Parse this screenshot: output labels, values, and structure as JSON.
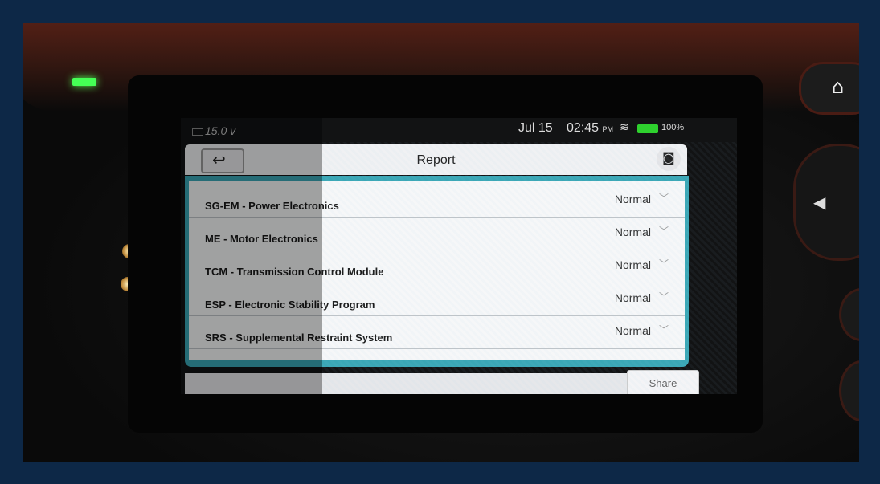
{
  "statusbar": {
    "voltage": "15.0 v",
    "date": "Jul 15",
    "time": "02:45",
    "ampm": "PM",
    "battery": "100%"
  },
  "report": {
    "title": "Report",
    "rows": [
      {
        "label": "SG-EM - Power Electronics",
        "status": "Normal"
      },
      {
        "label": "ME - Motor Electronics",
        "status": "Normal"
      },
      {
        "label": "TCM - Transmission Control Module",
        "status": "Normal"
      },
      {
        "label": "ESP - Electronic Stability Program",
        "status": "Normal"
      },
      {
        "label": "SRS - Supplemental Restraint System",
        "status": "Normal"
      }
    ],
    "share_label": "Share"
  },
  "icons": {
    "back": "back-arrow-icon",
    "camera": "camera-icon",
    "wifi": "wifi-icon",
    "home": "home-icon"
  },
  "colors": {
    "accent": "#3aa7b6",
    "battery": "#2ed12e",
    "led": "#45ff55"
  }
}
